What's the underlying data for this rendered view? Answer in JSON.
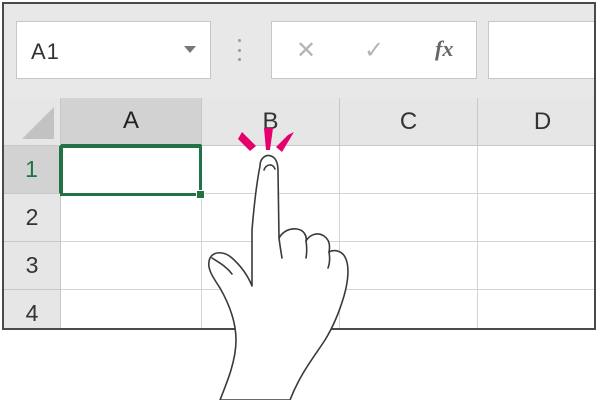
{
  "namebox": {
    "value": "A1"
  },
  "formula_bar": {
    "cancel_glyph": "✕",
    "enter_glyph": "✓",
    "fx_label": "fx",
    "value": ""
  },
  "columns": [
    "A",
    "B",
    "C",
    "D"
  ],
  "rows": [
    "1",
    "2",
    "3",
    "4"
  ],
  "active_cell": "A1",
  "colors": {
    "selection": "#217346",
    "tap_marks": "#e5006e"
  },
  "icons": [
    "dropdown-arrow-icon",
    "cancel-icon",
    "enter-icon",
    "function-icon",
    "pointing-hand-icon",
    "tap-indicator-icon"
  ]
}
